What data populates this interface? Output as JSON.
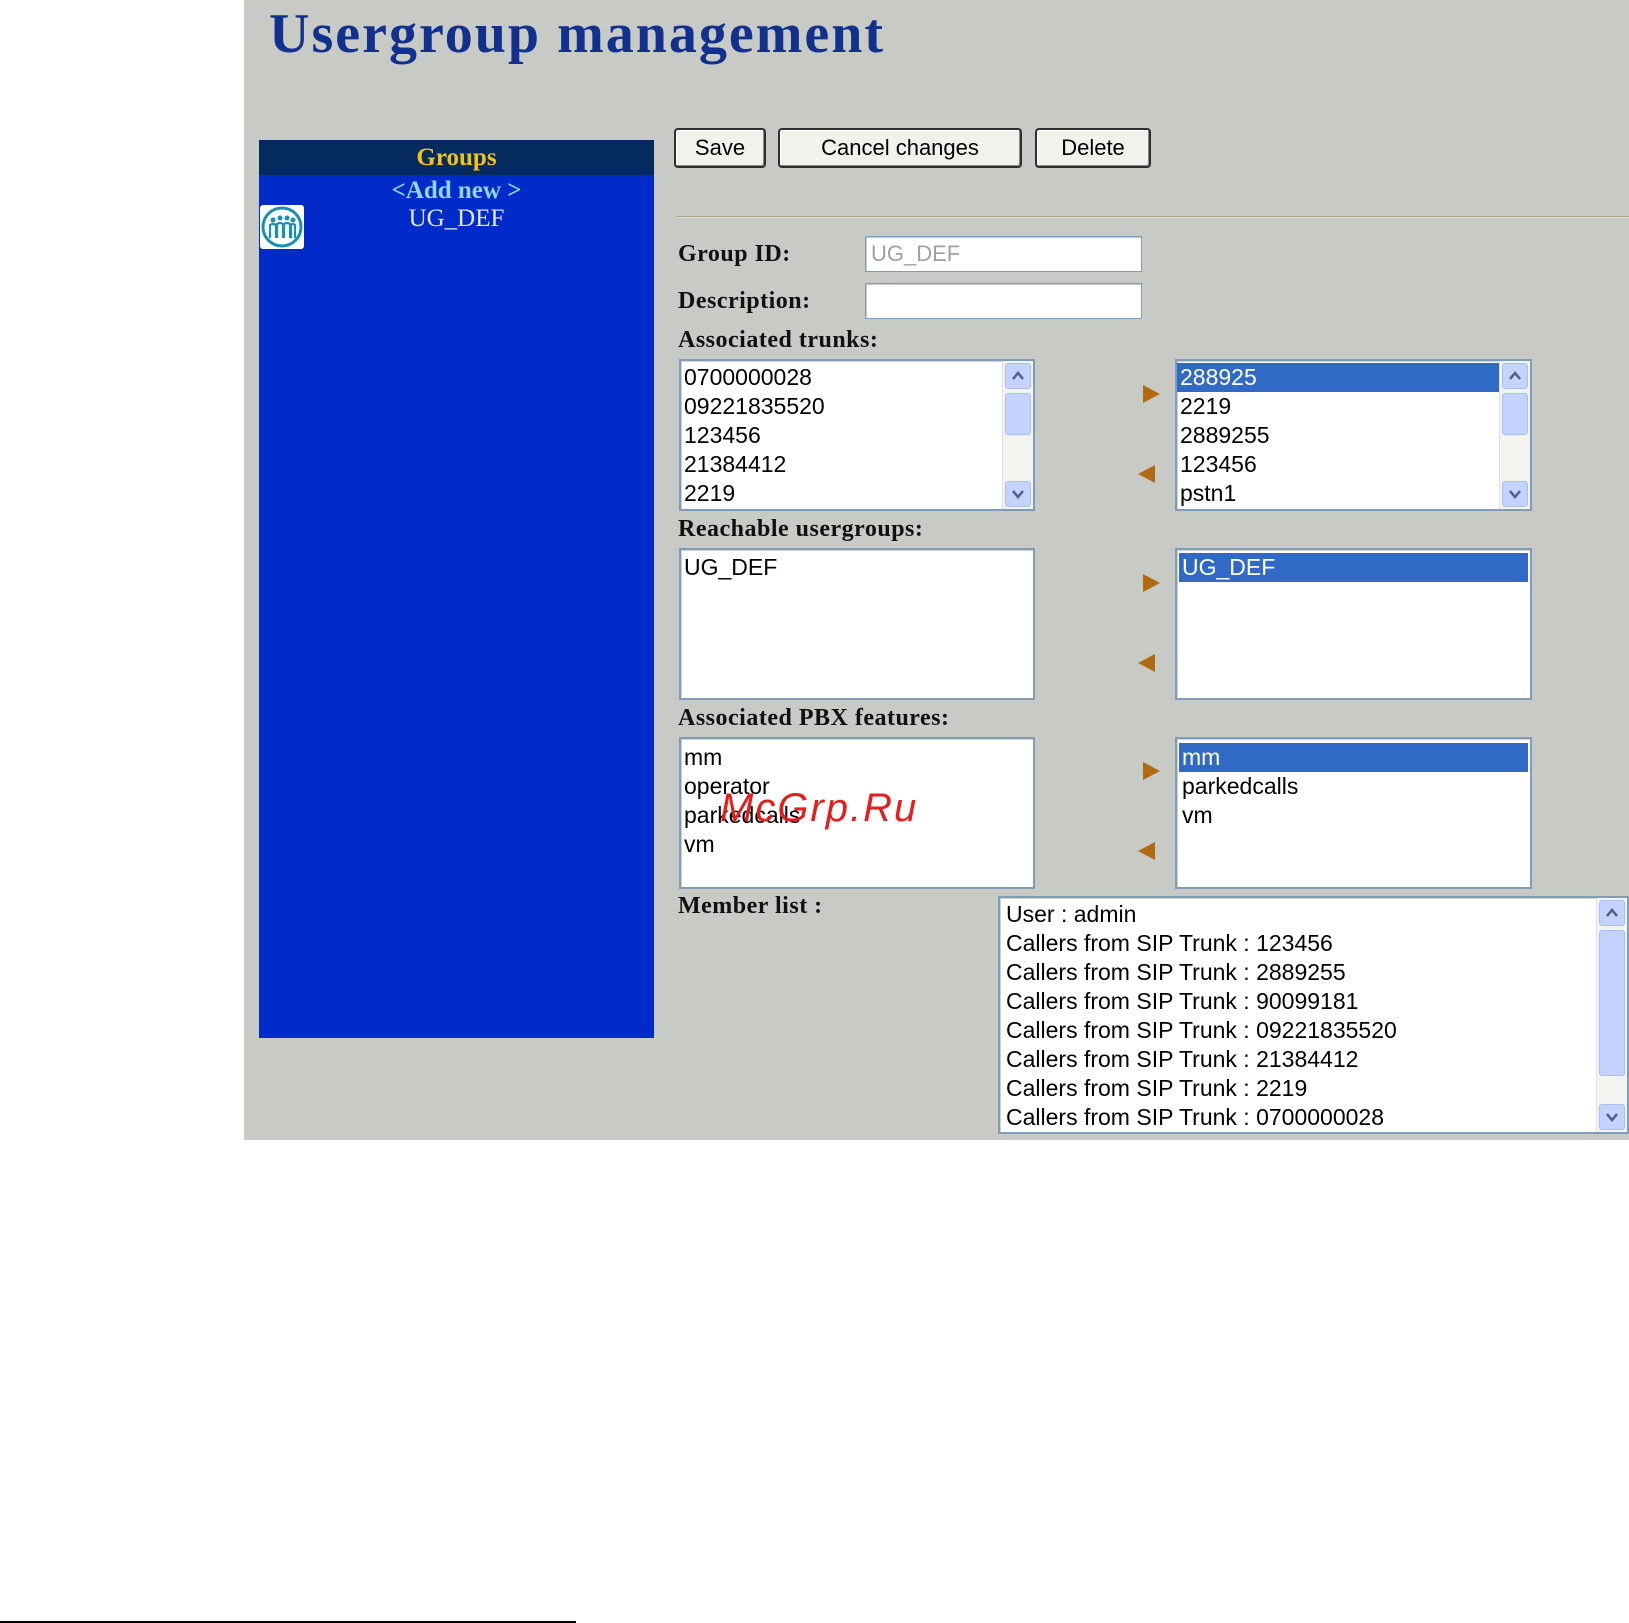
{
  "title": "Usergroup management",
  "groups": {
    "header": "Groups",
    "add_new": "<Add new >",
    "items": [
      {
        "name": "UG_DEF",
        "icon": "group-icon"
      }
    ]
  },
  "toolbar": {
    "save": "Save",
    "cancel": "Cancel changes",
    "delete": "Delete"
  },
  "form": {
    "group_id": {
      "label": "Group ID:",
      "value": "UG_DEF"
    },
    "description": {
      "label": "Description:",
      "value": ""
    },
    "trunks": {
      "label": "Associated trunks:",
      "available": [
        "0700000028",
        "09221835520",
        "123456",
        "21384412",
        "2219"
      ],
      "selected": [
        "288925",
        "2219",
        "2889255",
        "123456",
        "pstn1"
      ]
    },
    "usergroups": {
      "label": "Reachable usergroups:",
      "available": [
        "UG_DEF"
      ],
      "selected": [
        "UG_DEF"
      ]
    },
    "features": {
      "label": "Associated PBX features:",
      "available": [
        "mm",
        "operator",
        "parkedcalls",
        "vm"
      ],
      "selected": [
        "mm",
        "parkedcalls",
        "vm"
      ]
    },
    "members": {
      "label": "Member list :",
      "items": [
        "User : admin",
        "Callers from SIP Trunk : 123456",
        "Callers from SIP Trunk : 2889255",
        "Callers from SIP Trunk : 90099181",
        "Callers from SIP Trunk : 09221835520",
        "Callers from SIP Trunk : 21384412",
        "Callers from SIP Trunk : 2219",
        "Callers from SIP Trunk : 0700000028"
      ]
    }
  },
  "watermark": "McGrp.Ru",
  "colors": {
    "panel": "#c8cac6",
    "title": "#12318f",
    "sidebar": "#002bc9",
    "sidebar_header": "#052a5e",
    "groups_header_text": "#f0c419",
    "add_new_text": "#8fd6ff",
    "selection": "#316ac5",
    "arrow": "#b06a10",
    "watermark": "#e41d1d"
  }
}
